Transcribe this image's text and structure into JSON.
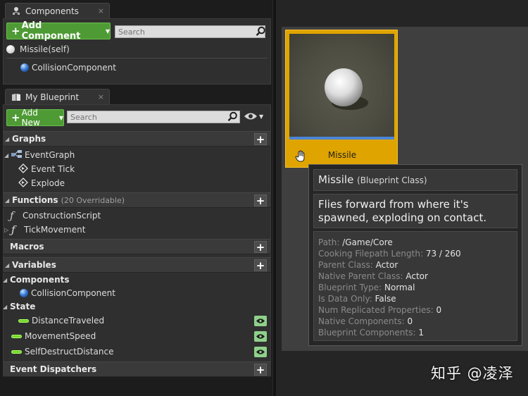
{
  "components_panel": {
    "tab_label": "Components",
    "tab_close": "×",
    "add_button_label": "Add Component",
    "search_placeholder": "Search",
    "root_item": "Missile(self)",
    "child_item": "CollisionComponent"
  },
  "blueprint_panel": {
    "tab_label": "My Blueprint",
    "tab_close": "×",
    "add_new_label": "Add New",
    "search_placeholder": "Search",
    "sections": {
      "graphs": {
        "label": "Graphs",
        "event_graph": "EventGraph",
        "items": [
          "Event Tick",
          "Explode"
        ]
      },
      "functions": {
        "label": "Functions",
        "overridable": "(20 Overridable)",
        "items": [
          "ConstructionScript",
          "TickMovement"
        ]
      },
      "macros": {
        "label": "Macros"
      },
      "variables": {
        "label": "Variables",
        "components_header": "Components",
        "components_items": [
          "CollisionComponent"
        ],
        "state_header": "State",
        "state_items": [
          "DistanceTraveled",
          "MovementSpeed",
          "SelfDestructDistance"
        ]
      },
      "event_dispatchers": {
        "label": "Event Dispatchers"
      }
    }
  },
  "asset": {
    "name": "Missile",
    "tooltip": {
      "title": "Missile",
      "class_label": "(Blueprint Class)",
      "description": "Flies forward from where it's spawned, exploding on contact.",
      "properties": [
        {
          "key": "Path:",
          "value": "/Game/Core"
        },
        {
          "key": "Cooking Filepath Length:",
          "value": "73 / 260"
        },
        {
          "key": "Parent Class:",
          "value": "Actor"
        },
        {
          "key": "Native Parent Class:",
          "value": "Actor"
        },
        {
          "key": "Blueprint Type:",
          "value": "Normal"
        },
        {
          "key": "Is Data Only:",
          "value": "False"
        },
        {
          "key": "Num Replicated Properties:",
          "value": "0"
        },
        {
          "key": "Native Components:",
          "value": "0"
        },
        {
          "key": "Blueprint Components:",
          "value": "1"
        }
      ]
    }
  },
  "watermark": "知乎 @凌泽",
  "colors": {
    "accent_green": "#4e9a35",
    "asset_highlight": "#e0a400",
    "variable_pill": "#7ad42e"
  }
}
